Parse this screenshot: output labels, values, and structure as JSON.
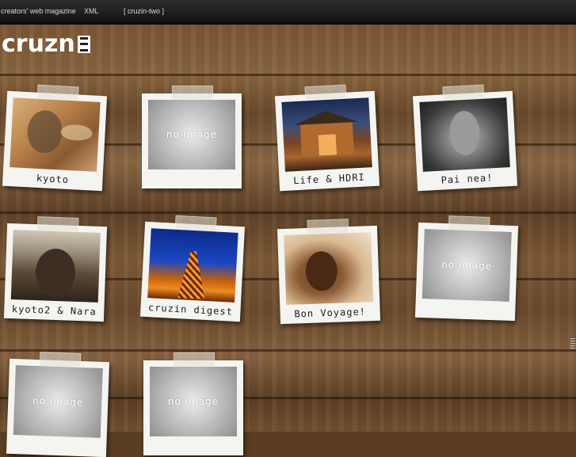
{
  "nav": {
    "items": [
      {
        "label": "creators' web magazine"
      },
      {
        "label": "XML"
      },
      {
        "label": "[ cruzin-two ]"
      }
    ]
  },
  "logo": {
    "text": "cruzn"
  },
  "cards": [
    {
      "caption": "kyoto",
      "image": "photo"
    },
    {
      "caption": "",
      "image": "no image"
    },
    {
      "caption": "Life & HDRI",
      "image": "photo"
    },
    {
      "caption": "Pai nea!",
      "image": "photo"
    },
    {
      "caption": "kyoto2 & Nara",
      "image": "photo"
    },
    {
      "caption": "cruzin digest",
      "image": "photo"
    },
    {
      "caption": "Bon Voyage!",
      "image": "photo"
    },
    {
      "caption": "",
      "image": "no image"
    },
    {
      "caption": "",
      "image": "no image"
    },
    {
      "caption": "",
      "image": "no image"
    }
  ],
  "colors": {
    "topbar": "#1c1c1c",
    "wood": "#7a5634",
    "card": "#f4f4f0"
  }
}
